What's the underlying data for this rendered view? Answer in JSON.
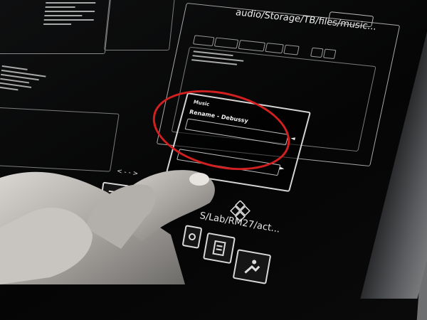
{
  "path_top": "audio/Storage/TB/files/music",
  "path_top_suffix": "...",
  "path_bottom": "S/Lab/RM27/act",
  "path_bottom_suffix": "...",
  "widget": {
    "heading": "Music",
    "track": "Rename - Debussy",
    "nav_label": "< - - >"
  },
  "highlight_color": "#d21f1f",
  "icons": [
    "list-icon",
    "hand-icon",
    "gear-icon",
    "document-icon",
    "person-icon",
    "diamond-cluster-icon"
  ]
}
